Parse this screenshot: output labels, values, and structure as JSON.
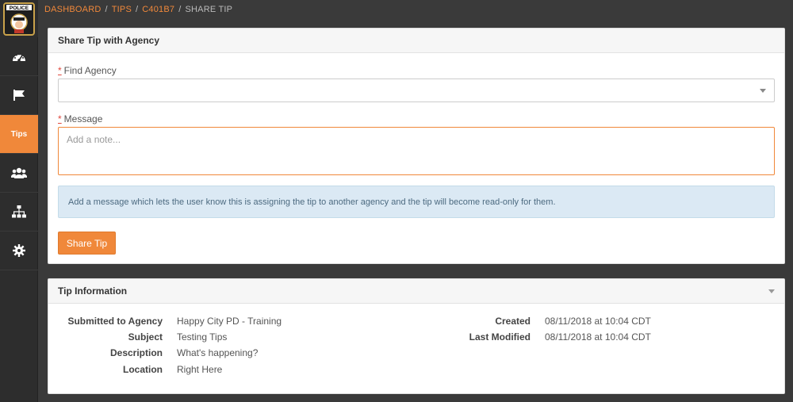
{
  "breadcrumb": {
    "items": [
      "DASHBOARD",
      "TIPS",
      "C401B7"
    ],
    "current": "SHARE TIP",
    "separator": "/"
  },
  "sidebar": {
    "logo_text": "POLICE",
    "items": [
      {
        "icon": "dashboard-icon"
      },
      {
        "icon": "flag-icon"
      },
      {
        "label": "Tips",
        "active": true
      },
      {
        "icon": "users-icon"
      },
      {
        "icon": "org-chart-icon"
      },
      {
        "icon": "gear-icon"
      }
    ]
  },
  "share_panel": {
    "title": "Share Tip with Agency",
    "find_agency_label": "Find Agency",
    "required_marker": "*",
    "message_label": "Message",
    "message_placeholder": "Add a note...",
    "message_value": "",
    "info_text": "Add a message which lets the user know this is assigning the tip to another agency and the tip will become read-only for them.",
    "share_button": "Share Tip"
  },
  "tip_info": {
    "title": "Tip Information",
    "left": [
      {
        "key": "Submitted to Agency",
        "value": "Happy City PD - Training"
      },
      {
        "key": "Subject",
        "value": "Testing Tips"
      },
      {
        "key": "Description",
        "value": "What's happening?"
      },
      {
        "key": "Location",
        "value": "Right Here"
      }
    ],
    "right": [
      {
        "key": "Created",
        "value": "08/11/2018 at 10:04 CDT"
      },
      {
        "key": "Last Modified",
        "value": "08/11/2018 at 10:04 CDT"
      }
    ]
  },
  "colors": {
    "accent": "#f0883a",
    "sidebar": "#2d2d2d",
    "info_bg": "#dbe9f4"
  }
}
